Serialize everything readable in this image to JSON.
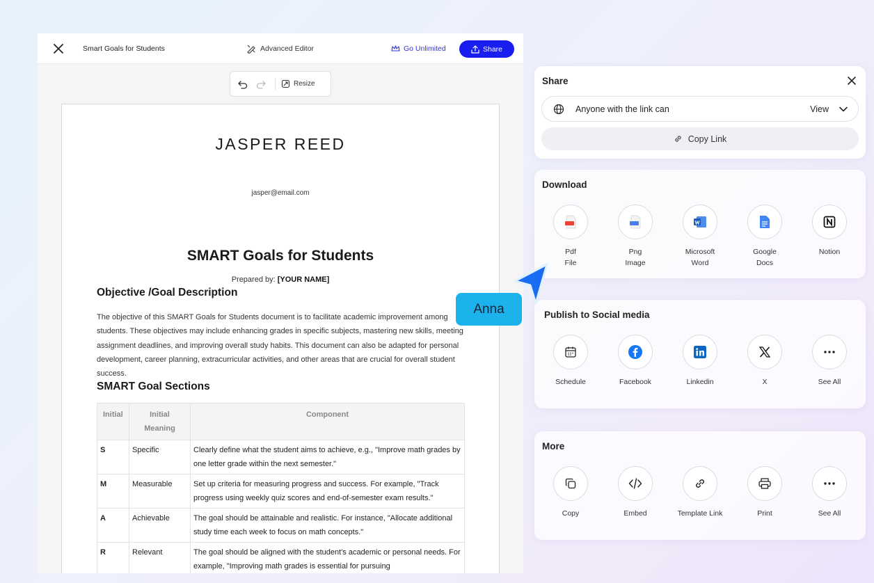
{
  "editor": {
    "doc_title": "Smart Goals for Students",
    "advanced_editor": "Advanced Editor",
    "go_unlimited": "Go Unlimited",
    "share": "Share",
    "resize": "Resize"
  },
  "document": {
    "name": "JASPER REED",
    "email": "jasper@email.com",
    "heading": "SMART Goals for Students",
    "prepared_label": "Prepared by:",
    "prepared_value": "[YOUR NAME]",
    "section1": "Objective /Goal Description",
    "paragraph": "The objective of this SMART Goals for Students document is to facilitate academic improvement among students. These objectives may include enhancing grades in specific subjects, mastering new skills, meeting assignment deadlines, and improving overall study habits. This document can also be adapted for personal development, career planning, extracurricular activities, and other areas that are crucial for overall student success.",
    "section2": "SMART Goal Sections",
    "table_headers": [
      "Initial",
      "Initial Meaning",
      "Component"
    ],
    "table_rows": [
      {
        "initial": "S",
        "meaning": "Specific",
        "component": "Clearly define what the student aims to achieve, e.g., \"Improve math grades by one letter grade within the next semester.\""
      },
      {
        "initial": "M",
        "meaning": "Measurable",
        "component": "Set up criteria for measuring progress and success. For example, \"Track progress using weekly quiz scores and end-of-semester exam results.\""
      },
      {
        "initial": "A",
        "meaning": "Achievable",
        "component": "The goal should be attainable and realistic. For instance, \"Allocate additional study time each week to focus on math concepts.\""
      },
      {
        "initial": "R",
        "meaning": "Relevant",
        "component": "The goal should be aligned with the student's academic or personal needs. For example, \"Improving math grades is essential for pursuing"
      }
    ]
  },
  "share_panel": {
    "title": "Share",
    "permission": "Anyone with the link can",
    "access": "View",
    "copy_link": "Copy Link"
  },
  "download": {
    "title": "Download",
    "items": [
      {
        "label": "Pdf\nFile",
        "icon": "pdf-file-icon"
      },
      {
        "label": "Png\nImage",
        "icon": "png-image-icon"
      },
      {
        "label": "Microsoft\nWord",
        "icon": "microsoft-word-icon"
      },
      {
        "label": "Google\nDocs",
        "icon": "google-docs-icon"
      },
      {
        "label": "Notion",
        "icon": "notion-icon"
      }
    ]
  },
  "social": {
    "title": "Publish to Social media",
    "items": [
      {
        "label": "Schedule",
        "icon": "calendar-icon"
      },
      {
        "label": "Facebook",
        "icon": "facebook-icon"
      },
      {
        "label": "Linkedin",
        "icon": "linkedin-icon"
      },
      {
        "label": "X",
        "icon": "x-logo-icon"
      },
      {
        "label": "See All",
        "icon": "more-dots-icon"
      }
    ]
  },
  "more": {
    "title": "More",
    "items": [
      {
        "label": "Copy",
        "icon": "copy-icon"
      },
      {
        "label": "Embed",
        "icon": "code-icon"
      },
      {
        "label": "Template Link",
        "icon": "link-icon"
      },
      {
        "label": "Print",
        "icon": "printer-icon"
      },
      {
        "label": "See All",
        "icon": "more-dots-icon"
      }
    ]
  },
  "collaborator": {
    "name": "Anna",
    "color": "#1cb2ec"
  },
  "colors": {
    "accent": "#1a1df0",
    "facebook": "#1877f2",
    "linkedin": "#0a66c2"
  }
}
